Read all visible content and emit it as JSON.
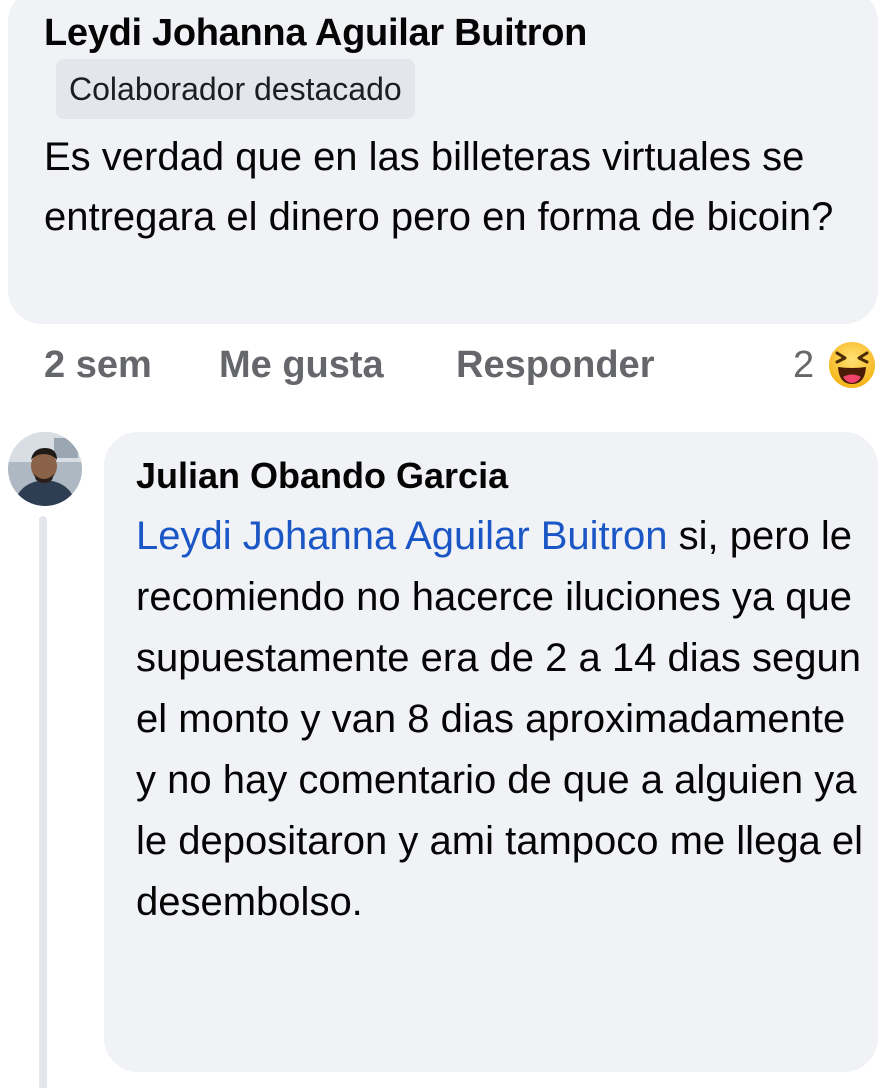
{
  "comment": {
    "author": "Leydi Johanna Aguilar Buitron",
    "badge": "Colaborador destacado",
    "text": "Es verdad que en las billeteras virtuales se entregara el dinero pero en forma de bicoin?",
    "actions": {
      "time": "2 sem",
      "like": "Me gusta",
      "reply": "Responder"
    },
    "reactions": {
      "count": "2",
      "icon": "laughing-emoji-icon"
    }
  },
  "reply": {
    "author": "Julian Obando Garcia",
    "mention": "Leydi Johanna Aguilar Buitron",
    "text": " si, pero le recomiendo no hacerce iluciones ya que supuestamente era de 2 a 14 dias segun el monto y van 8 dias aproximadamente y no hay comentario de que a alguien ya le depositaron y ami tampoco me llega el desembolso.",
    "avatar_icon": "user-avatar"
  },
  "colors": {
    "bubble": "#f0f2f5",
    "secondary_text": "#65676b",
    "mention": "#1a56c5",
    "badge_bg": "#e4e6eb"
  }
}
